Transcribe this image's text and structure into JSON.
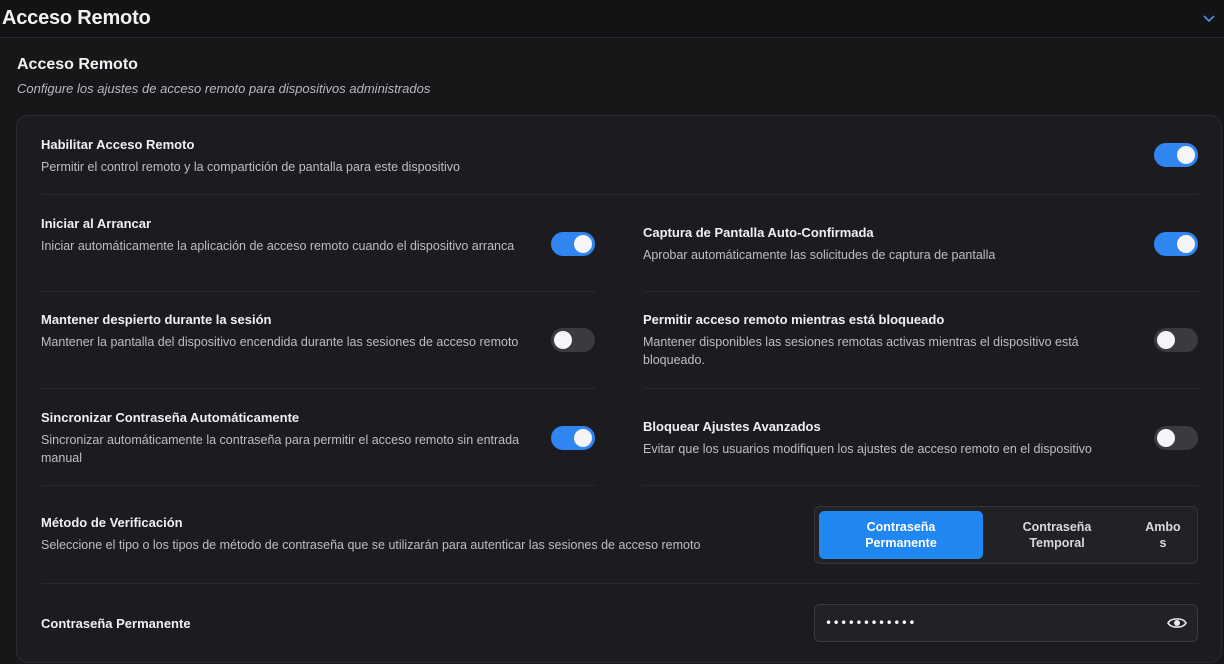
{
  "header": {
    "title": "Acceso Remoto"
  },
  "section": {
    "title": "Acceso Remoto",
    "subtitle": "Configure los ajustes de acceso remoto para dispositivos administrados"
  },
  "settings": {
    "enable": {
      "title": "Habilitar Acceso Remoto",
      "desc": "Permitir el control remoto y la compartición de pantalla para este dispositivo",
      "on": true
    },
    "start_on_boot": {
      "title": "Iniciar al Arrancar",
      "desc": "Iniciar automáticamente la aplicación de acceso remoto cuando el dispositivo arranca",
      "on": true
    },
    "auto_capture": {
      "title": "Captura de Pantalla Auto-Confirmada",
      "desc": "Aprobar automáticamente las solicitudes de captura de pantalla",
      "on": true
    },
    "keep_awake": {
      "title": "Mantener despierto durante la sesión",
      "desc": "Mantener la pantalla del dispositivo encendida durante las sesiones de acceso remoto",
      "on": false
    },
    "allow_locked": {
      "title": "Permitir acceso remoto mientras está bloqueado",
      "desc": "Mantener disponibles las sesiones remotas activas mientras el dispositivo está bloqueado.",
      "on": false
    },
    "sync_password": {
      "title": "Sincronizar Contraseña Automáticamente",
      "desc": "Sincronizar automáticamente la contraseña para permitir el acceso remoto sin entrada manual",
      "on": true
    },
    "lock_advanced": {
      "title": "Bloquear Ajustes Avanzados",
      "desc": "Evitar que los usuarios modifiquen los ajustes de acceso remoto en el dispositivo",
      "on": false
    }
  },
  "verification": {
    "title": "Método de Verificación",
    "desc": "Seleccione el tipo o los tipos de método de contraseña que se utilizarán para autenticar las sesiones de acceso remoto",
    "options": [
      {
        "line1": "Contraseña",
        "line2": "Permanente",
        "active": true
      },
      {
        "line1": "Contraseña",
        "line2": "Temporal",
        "active": false
      },
      {
        "line1": "Ambo",
        "line2": "s",
        "active": false
      }
    ]
  },
  "permanent_password": {
    "label": "Contraseña Permanente",
    "value": "••••••••••••"
  },
  "colors": {
    "accent": "#2f86f1",
    "toggle_off": "#3a3a40",
    "card_bg": "#1c1c20",
    "page_bg": "#131316"
  },
  "icons": {
    "collapse": "chevron-down-icon",
    "reveal": "eye-icon"
  }
}
